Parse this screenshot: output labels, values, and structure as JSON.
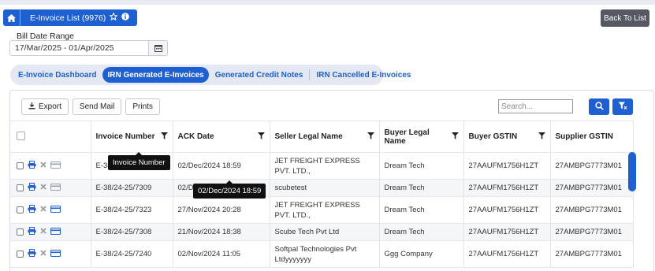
{
  "header": {
    "title": "E-Invoice List (9976)",
    "back_label": "Back To List"
  },
  "filter": {
    "label": "Bill Date Range",
    "value": "17/Mar/2025 - 01/Apr/2025"
  },
  "tabs": [
    {
      "label": "E-Invoice Dashboard",
      "active": false
    },
    {
      "label": "IRN Generated E-Invoices",
      "active": true
    },
    {
      "label": "Generated Credit Notes",
      "active": false
    },
    {
      "label": "IRN Cancelled E-Invoices",
      "active": false
    }
  ],
  "toolbar": {
    "export_label": "Export",
    "send_mail_label": "Send Mail",
    "prints_label": "Prints",
    "search_placeholder": "Search..."
  },
  "table": {
    "columns": [
      "Invoice Number",
      "ACK Date",
      "Seller Legal Name",
      "Buyer Legal Name",
      "Buyer GSTIN",
      "Supplier GSTIN"
    ],
    "rows": [
      {
        "invoice": "E-38/24-25/7314",
        "ack": "02/Dec/2024 18:59",
        "seller": "JET FREIGHT EXPRESS PVT. LTD.,",
        "buyer": "Dream Tech",
        "buyer_gstin": "27AAUFM1756H1ZT",
        "supplier_gstin": "27AMBPG7773M01"
      },
      {
        "invoice": "E-38/24-25/7309",
        "ack": "02/Dec/2024 18:59",
        "seller": "scubetest",
        "buyer": "Dream Tech",
        "buyer_gstin": "27AAUFM1756H1ZT",
        "supplier_gstin": "27AMBPG7773M01"
      },
      {
        "invoice": "E-38/24-25/7323",
        "ack": "27/Nov/2024 20:28",
        "seller": "JET FREIGHT EXPRESS PVT. LTD.,",
        "buyer": "Dream Tech",
        "buyer_gstin": "27AAUFM1756H1ZT",
        "supplier_gstin": "27AMBPG7773M01"
      },
      {
        "invoice": "E-38/24-25/7308",
        "ack": "21/Nov/2024 18:38",
        "seller": "Scube Tech Pvt Ltd",
        "buyer": "Dream Tech",
        "buyer_gstin": "27AAUFM1756H1ZT",
        "supplier_gstin": "27AMBPG7773M01"
      },
      {
        "invoice": "E-38/24-25/7240",
        "ack": "02/Nov/2024 11:05",
        "seller": "Softpal Technologies Pvt Ltdyyyyyyy",
        "buyer": "Ggg Company",
        "buyer_gstin": "27AAUFM1756H1ZT",
        "supplier_gstin": "27AMBPG7773M01"
      }
    ]
  },
  "tooltips": {
    "invoice_header": "Invoice Number",
    "ack_cell": "02/Dec/2024 18:59"
  },
  "colors": {
    "primary": "#1e5fd1",
    "back_button": "#555a62"
  }
}
